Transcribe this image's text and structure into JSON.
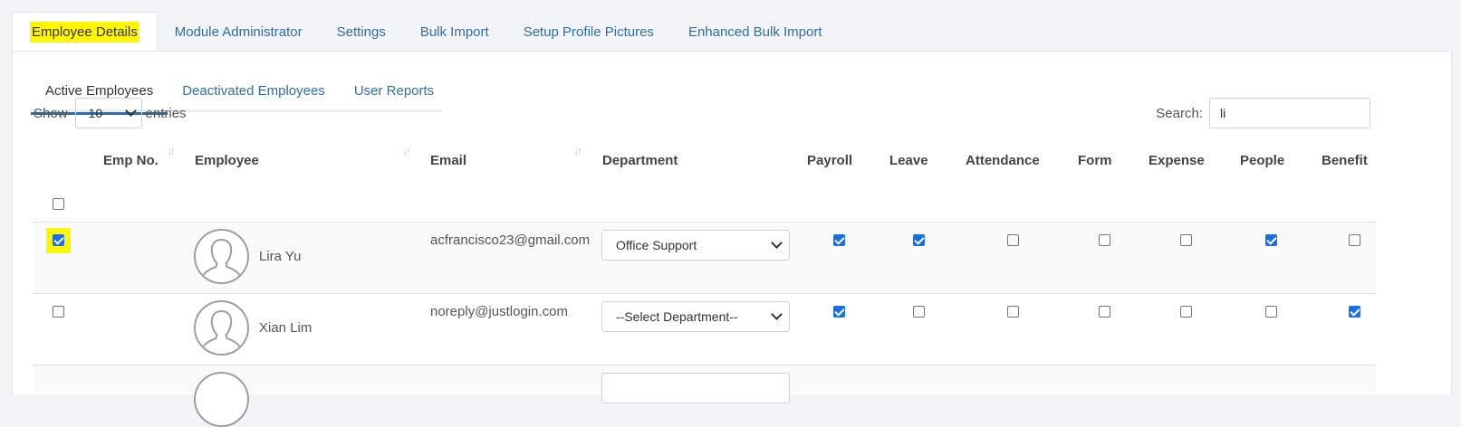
{
  "top_tabs": [
    {
      "label": "Employee Details",
      "active": true
    },
    {
      "label": "Module Administrator"
    },
    {
      "label": "Settings"
    },
    {
      "label": "Bulk Import"
    },
    {
      "label": "Setup Profile Pictures"
    },
    {
      "label": "Enhanced Bulk Import"
    }
  ],
  "sub_tabs": [
    {
      "label": "Active Employees",
      "active": true
    },
    {
      "label": "Deactivated Employees"
    },
    {
      "label": "User Reports"
    }
  ],
  "length": {
    "show_label": "Show",
    "value": "10",
    "entries_label": "entries"
  },
  "search": {
    "label": "Search:",
    "value": "li"
  },
  "columns": {
    "emp_no": "Emp No.",
    "employee": "Employee",
    "email": "Email",
    "department": "Department",
    "payroll": "Payroll",
    "leave": "Leave",
    "attendance": "Attendance",
    "form": "Form",
    "expense": "Expense",
    "people": "People",
    "benefit": "Benefit"
  },
  "rows": [
    {
      "selected": true,
      "emp_no": "",
      "name": "Lira Yu",
      "email": "acfrancisco23@gmail.com",
      "department": "Office Support",
      "modules": {
        "payroll": true,
        "leave": true,
        "attendance": false,
        "form": false,
        "expense": false,
        "people": true,
        "benefit": false
      }
    },
    {
      "selected": false,
      "emp_no": "",
      "name": "Xian Lim",
      "email": "noreply@justlogin.com",
      "department": "--Select Department--",
      "modules": {
        "payroll": true,
        "leave": false,
        "attendance": false,
        "form": false,
        "expense": false,
        "people": false,
        "benefit": true
      }
    }
  ],
  "colors": {
    "accent": "#2f6ea5",
    "highlight": "#fff600",
    "checkbox_on": "#1a6ee6"
  }
}
